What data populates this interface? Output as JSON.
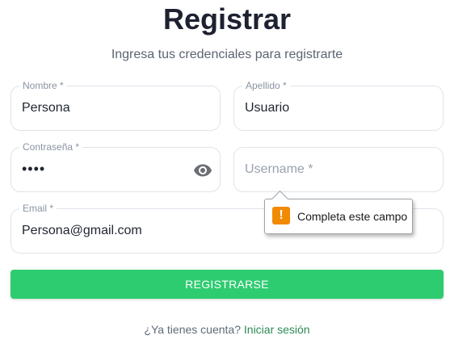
{
  "header": {
    "title": "Registrar",
    "subtitle": "Ingresa tus credenciales para registrarte"
  },
  "form": {
    "nombre": {
      "label": "Nombre *",
      "value": "Persona"
    },
    "apellido": {
      "label": "Apellido *",
      "value": "Usuario"
    },
    "contrasena": {
      "label": "Contraseña *",
      "value_masked": "••••",
      "toggle_icon": "eye-icon"
    },
    "username": {
      "placeholder": "Username *",
      "value": ""
    },
    "email": {
      "label": "Email *",
      "value": "Persona@gmail.com"
    },
    "submit_label": "REGISTRARSE"
  },
  "validation_tooltip": {
    "icon": "warning-icon",
    "icon_glyph": "!",
    "text": "Completa este campo"
  },
  "footer": {
    "prompt": "¿Ya tienes cuenta?",
    "link": "Iniciar sesión"
  },
  "colors": {
    "accent": "#2ecc71",
    "link": "#2d8a55",
    "warning": "#f28a00"
  }
}
